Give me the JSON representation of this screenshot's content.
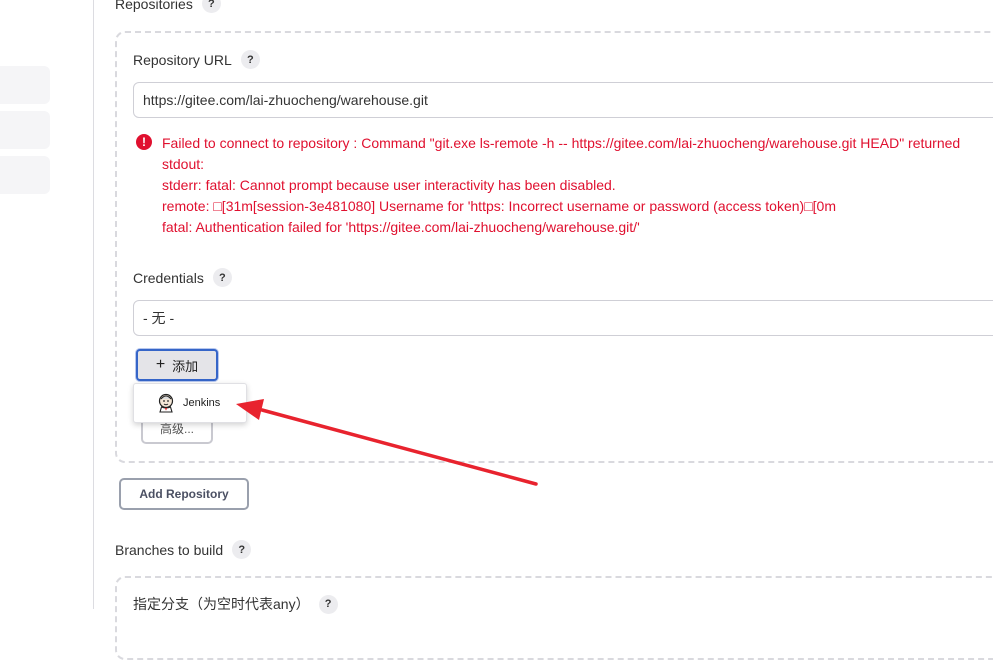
{
  "sections": {
    "repositories_label": "Repositories",
    "branches_label": "Branches to build",
    "help_glyph": "?"
  },
  "repo": {
    "url_label": "Repository URL",
    "url_value": "https://gitee.com/lai-zhuocheng/warehouse.git",
    "error_icon_glyph": "!",
    "error_lines": [
      "Failed to connect to repository : Command \"git.exe ls-remote -h -- https://gitee.com/lai-zhuocheng/warehouse.git HEAD\" returned",
      "stdout:",
      "stderr: fatal: Cannot prompt because user interactivity has been disabled.",
      "remote: □[31m[session-3e481080] Username for 'https: Incorrect username or password (access token)□[0m",
      "fatal: Authentication failed for 'https://gitee.com/lai-zhuocheng/warehouse.git/'"
    ],
    "credentials_label": "Credentials",
    "credentials_value": "- 无 -",
    "add_button_icon": "+",
    "add_button_label": "添加",
    "advanced_button_label": "高级...",
    "dropdown_items": [
      {
        "label": "Jenkins",
        "icon": "jenkins-icon"
      }
    ],
    "add_repository_label": "Add Repository"
  },
  "branches": {
    "branch_spec_label": "指定分支（为空时代表any）"
  },
  "colors": {
    "error": "#e0102f",
    "focus_border": "#3565c8",
    "arrow": "#e8232e"
  }
}
